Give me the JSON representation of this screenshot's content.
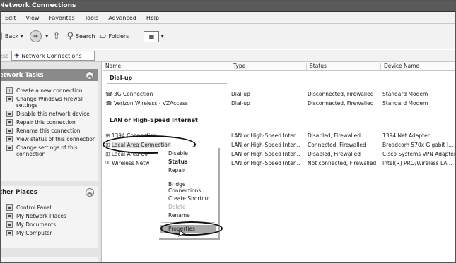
{
  "window": {
    "title": "Network Connections"
  },
  "menu": [
    "Edit",
    "View",
    "Favorites",
    "Tools",
    "Advanced",
    "Help"
  ],
  "toolbar": {
    "back": "Back",
    "search": "Search",
    "folders": "Folders"
  },
  "address": {
    "label": "ess",
    "value": "Network Connections"
  },
  "tasks_panel": {
    "title": "etwork Tasks",
    "items": [
      "Create a new connection",
      "Change Windows Firewall settings",
      "Disable this network device",
      "Repair this connection",
      "Rename this connection",
      "View status of this connection",
      "Change settings of this connection"
    ]
  },
  "places_panel": {
    "title": "ther Places",
    "items": [
      "Control Panel",
      "My Network Places",
      "My Documents",
      "My Computer"
    ]
  },
  "columns": [
    "Name",
    "Type",
    "Status",
    "Device Name"
  ],
  "groups": {
    "dialup": "Dial-up",
    "lan": "LAN or High-Speed Internet"
  },
  "dialup_rows": [
    {
      "name": "3G Connection",
      "type": "Dial-up",
      "status": "Disconnected, Firewalled",
      "device": "Standard Modem"
    },
    {
      "name": "Verizon Wireless - VZAccess",
      "type": "Dial-up",
      "status": "Disconnected, Firewalled",
      "device": "Standard Modem"
    }
  ],
  "lan_rows": [
    {
      "name": "1394 Connection",
      "type": "LAN or High-Speed Inter...",
      "status": "Disabled, Firewalled",
      "device": "1394 Net Adapter"
    },
    {
      "name": "Local Area Connection",
      "type": "LAN or High-Speed Inter...",
      "status": "Connected, Firewalled",
      "device": "Broadcom 570x Gigabit I..."
    },
    {
      "name": "Local Area Co",
      "type": "LAN or High-Speed Inter...",
      "status": "Disabled, Firewalled",
      "device": "Cisco Systems VPN Adapter"
    },
    {
      "name": "Wireless Netw",
      "type": "LAN or High-Speed Inter...",
      "status": "Not connected, Firewalled",
      "device": "Intel(R) PRO/Wireless LA..."
    }
  ],
  "context_menu": {
    "disable": "Disable",
    "status": "Status",
    "repair": "Repair",
    "bridge": "Bridge Connections",
    "shortcut": "Create Shortcut",
    "delete": "Delete",
    "rename": "Rename",
    "properties": "Properties"
  }
}
